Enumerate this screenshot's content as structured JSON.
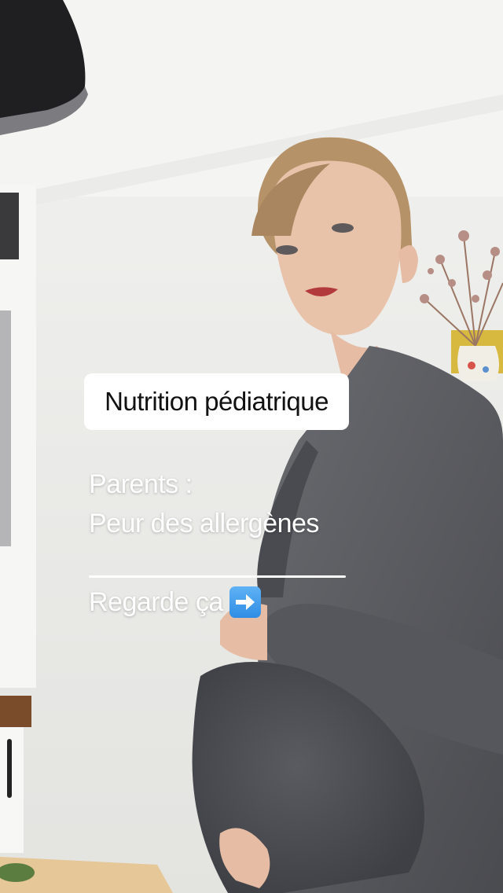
{
  "overlay": {
    "title": "Nutrition pédiatrique",
    "line1": "Parents :",
    "line2": "Peur des allergènes",
    "cta": "Regarde ça",
    "cta_icon": "right-arrow-emoji-icon"
  }
}
